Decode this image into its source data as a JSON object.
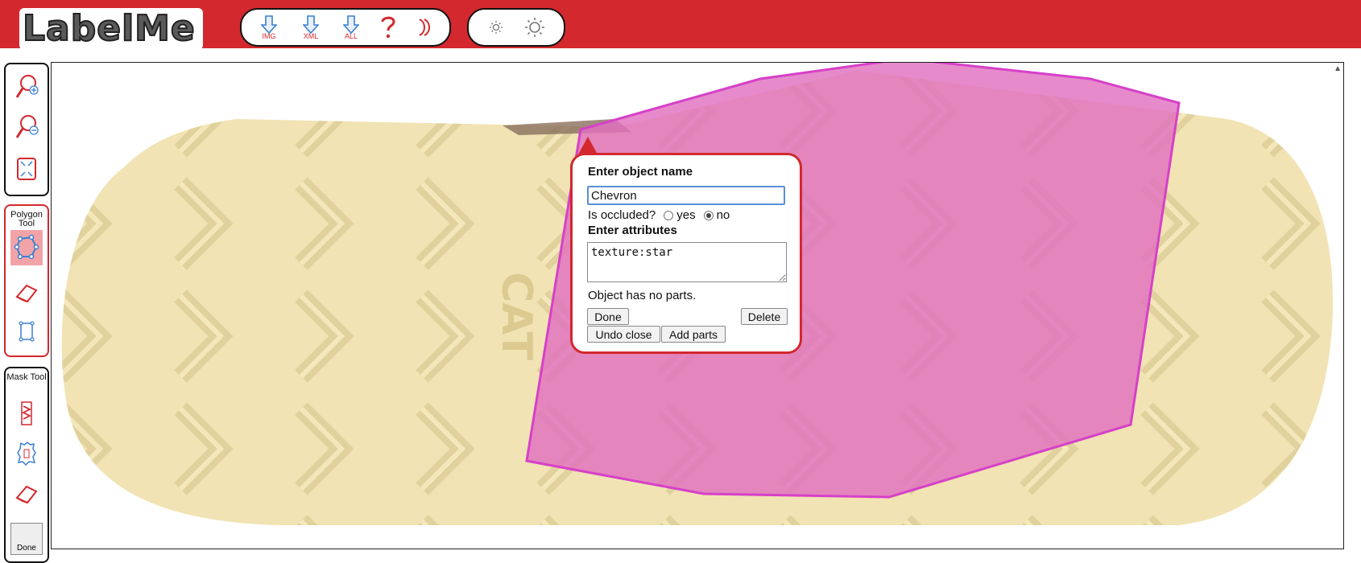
{
  "app": {
    "logo_text": "LabelMe"
  },
  "toolbar": {
    "download_img_label": "IMG",
    "download_xml_label": "XML",
    "download_all_label": "ALL",
    "brand_color": "#d2282e"
  },
  "left_tools": {
    "polygon_title": "Polygon Tool",
    "mask_title": "Mask Tool",
    "mask_done_label": "Done"
  },
  "dialog": {
    "title": "Enter object name",
    "name_value": "Chevron",
    "occluded_label": "Is occluded?",
    "occluded_yes": "yes",
    "occluded_no": "no",
    "occluded_selected": "no",
    "attributes_title": "Enter attributes",
    "attributes_value": "texture:star",
    "parts_text": "Object has no parts.",
    "done_label": "Done",
    "delete_label": "Delete",
    "undo_close_label": "Undo close",
    "add_parts_label": "Add parts"
  },
  "annotation": {
    "fill_color": "#e070c0",
    "stroke_color": "#d640c8"
  }
}
